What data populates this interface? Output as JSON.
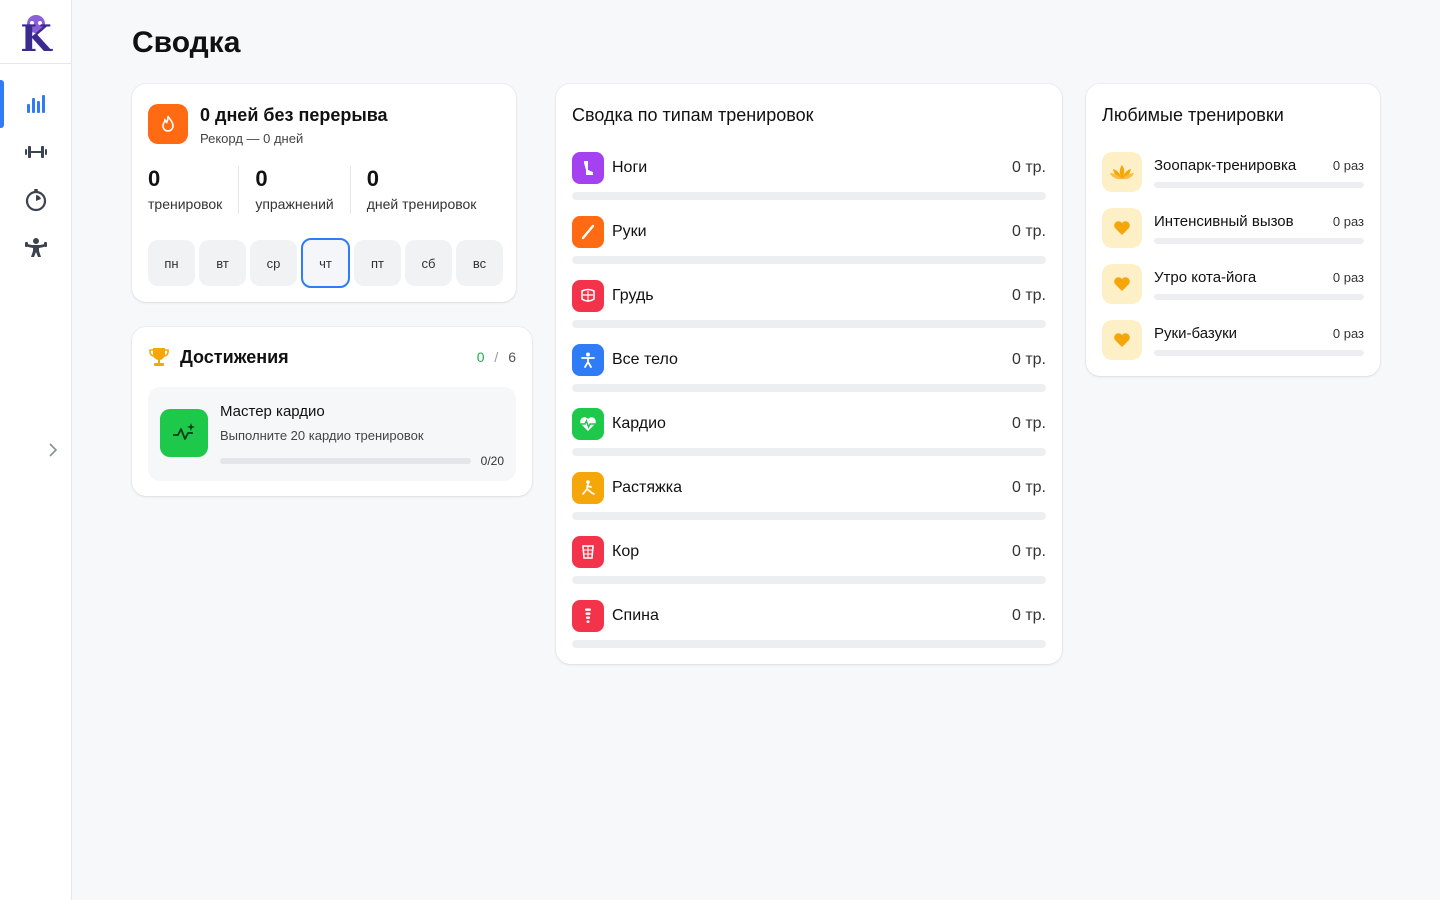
{
  "page": {
    "title": "Сводка"
  },
  "sidebar": {
    "logo_letter": "K",
    "items": [
      {
        "name": "stats-icon",
        "active": true
      },
      {
        "name": "dumbbell-icon",
        "active": false
      },
      {
        "name": "timer-icon",
        "active": false
      },
      {
        "name": "strongman-icon",
        "active": false
      }
    ]
  },
  "streak": {
    "title": "0 дней без перерыва",
    "subtitle": "Рекорд — 0 дней",
    "stats": [
      {
        "value": "0",
        "label": "тренировок"
      },
      {
        "value": "0",
        "label": "упражнений"
      },
      {
        "value": "0",
        "label": "дней тренировок"
      }
    ],
    "days": [
      "пн",
      "вт",
      "ср",
      "чт",
      "пт",
      "сб",
      "вс"
    ],
    "today_index": 3
  },
  "achievements": {
    "title": "Достижения",
    "done": "0",
    "sep": "/",
    "total": "6",
    "item": {
      "name": "Мастер кардио",
      "description": "Выполните 20 кардио тренировок",
      "progress_text": "0/20",
      "progress": 0
    }
  },
  "types": {
    "title": "Сводка по типам тренировок",
    "items": [
      {
        "label": "Ноги",
        "value": "0 тр.",
        "color": "#a441f0",
        "icon": "leg-icon",
        "progress": 0
      },
      {
        "label": "Руки",
        "value": "0 тр.",
        "color": "#ff6a13",
        "icon": "arm-icon",
        "progress": 0
      },
      {
        "label": "Грудь",
        "value": "0 тр.",
        "color": "#f2334a",
        "icon": "chest-icon",
        "progress": 0
      },
      {
        "label": "Все тело",
        "value": "0 тр.",
        "color": "#2f7cf6",
        "icon": "person-icon",
        "progress": 0
      },
      {
        "label": "Кардио",
        "value": "0 тр.",
        "color": "#1ec84a",
        "icon": "heart-pulse-icon",
        "progress": 0
      },
      {
        "label": "Растяжка",
        "value": "0 тр.",
        "color": "#f5a70a",
        "icon": "stretch-icon",
        "progress": 0
      },
      {
        "label": "Кор",
        "value": "0 тр.",
        "color": "#f2334a",
        "icon": "core-icon",
        "progress": 0
      },
      {
        "label": "Спина",
        "value": "0 тр.",
        "color": "#f2334a",
        "icon": "spine-icon",
        "progress": 0
      }
    ]
  },
  "favorites": {
    "title": "Любимые тренировки",
    "items": [
      {
        "label": "Зоопарк-тренировка",
        "value": "0 раз",
        "icon": "lotus-icon",
        "progress": 0
      },
      {
        "label": "Интенсивный вызов",
        "value": "0 раз",
        "icon": "heart-icon",
        "progress": 0
      },
      {
        "label": "Утро кота-йога",
        "value": "0 раз",
        "icon": "heart-icon",
        "progress": 0
      },
      {
        "label": "Руки-базуки",
        "value": "0 раз",
        "icon": "heart-icon",
        "progress": 0
      }
    ]
  }
}
